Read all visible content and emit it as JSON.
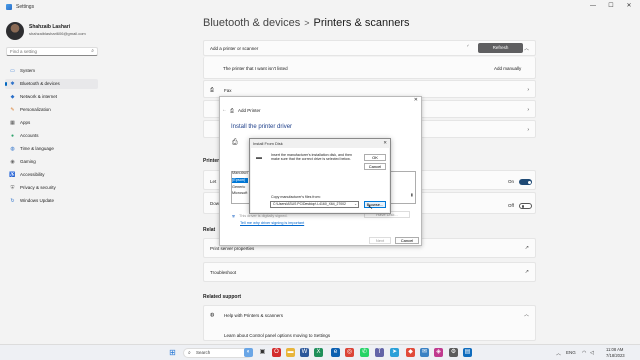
{
  "window": {
    "title": "Settings",
    "minimize": "—",
    "maximize": "☐",
    "close": "✕"
  },
  "user": {
    "name": "Shahzaib Lashari",
    "email": "shahzaiblashari606@gmail.com"
  },
  "search": {
    "placeholder": "Find a setting"
  },
  "nav": [
    {
      "label": "System",
      "icon": "system-icon"
    },
    {
      "label": "Bluetooth & devices",
      "icon": "bluetooth-icon"
    },
    {
      "label": "Network & internet",
      "icon": "network-icon"
    },
    {
      "label": "Personalization",
      "icon": "brush-icon"
    },
    {
      "label": "Apps",
      "icon": "apps-icon"
    },
    {
      "label": "Accounts",
      "icon": "accounts-icon"
    },
    {
      "label": "Time & language",
      "icon": "globe-icon"
    },
    {
      "label": "Gaming",
      "icon": "gaming-icon"
    },
    {
      "label": "Accessibility",
      "icon": "accessibility-icon"
    },
    {
      "label": "Privacy & security",
      "icon": "shield-icon"
    },
    {
      "label": "Windows Update",
      "icon": "update-icon"
    }
  ],
  "breadcrumb": {
    "parent": "Bluetooth & devices",
    "separator": ">",
    "current": "Printers & scanners"
  },
  "main": {
    "add_printer_label": "Add a printer or scanner",
    "refresh_label": "Refresh",
    "not_listed_label": "The printer that I want isn't listed",
    "add_manually_label": "Add manually",
    "fax_label": "Fax",
    "printer_prefs_heading": "Printer",
    "let_windows_label": "Let",
    "toggle1_state": "On",
    "download_label": "Dow",
    "toggle2_state": "Off",
    "related_heading": "Relat",
    "print_server_label": "Print server properties",
    "troubleshoot_label": "Troubleshoot",
    "related_support_heading": "Related support",
    "help_label": "Help with Printers & scanners",
    "learn_about_label": "Learn about Control panel options moving to Settings"
  },
  "add_printer_dialog": {
    "title": "Add Printer",
    "heading": "Install the printer driver",
    "manufacturer_header": "Manufact",
    "manufacturers": [
      "(Epson)",
      "Generic",
      "Microsoft"
    ],
    "signed_text": "This driver is digitally signed.",
    "why_link": "Tell me why driver signing is important",
    "have_disk": "Have Disk...",
    "next": "Next",
    "cancel": "Cancel",
    "close": "✕"
  },
  "install_disk_dialog": {
    "title": "Install From Disk",
    "close": "✕",
    "message": "Insert the manufacturer's installation disk, and then make sure that the correct drive is selected below.",
    "ok": "OK",
    "cancel": "Cancel",
    "copy_label": "Copy manufacturer's files from:",
    "path_value": "C:\\Users\\ASUS PC\\Desktop\\ L4160_X64_27002",
    "browse": "Browse..."
  },
  "taskbar": {
    "search_label": "Search",
    "time": "11:08 AM",
    "date": "7/18/2023",
    "lang": "ENG"
  }
}
